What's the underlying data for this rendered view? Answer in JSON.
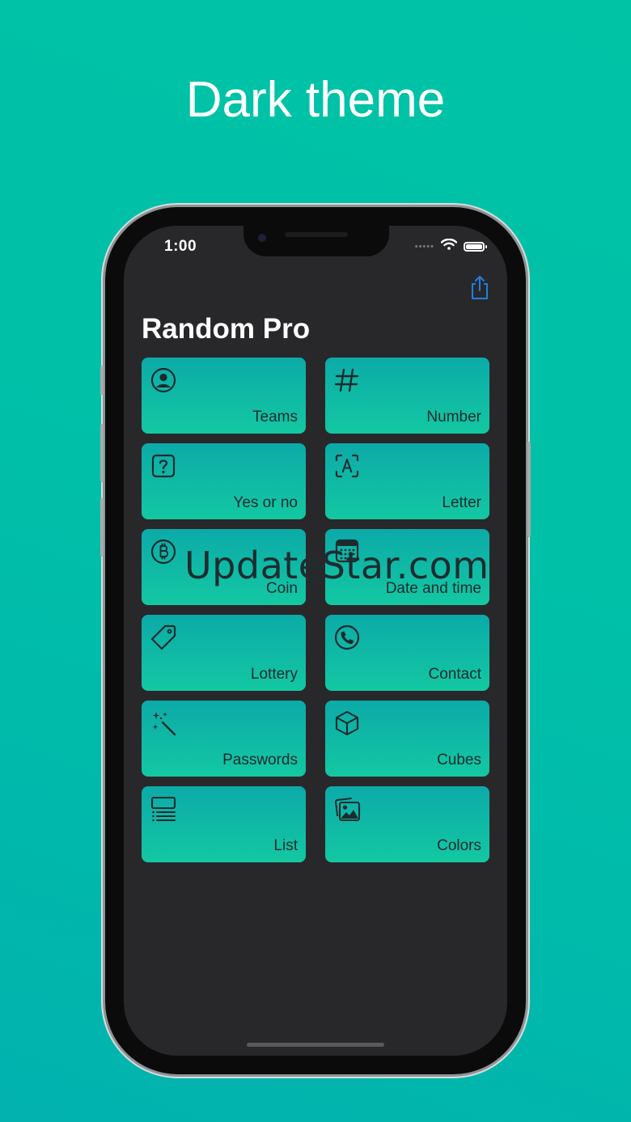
{
  "headline": "Dark theme",
  "status_bar": {
    "time": "1:00",
    "signal_dots": "•••••"
  },
  "app": {
    "title": "Random Pro",
    "accent_color": "#1f80e0",
    "tile_gradient": [
      "#0caaa8",
      "#13c8a2"
    ],
    "tiles": [
      {
        "label": "Teams",
        "icon": "person-circle-icon"
      },
      {
        "label": "Number",
        "icon": "hash-icon"
      },
      {
        "label": "Yes or no",
        "icon": "question-square-icon"
      },
      {
        "label": "Letter",
        "icon": "letter-a-icon"
      },
      {
        "label": "Coin",
        "icon": "bitcoin-icon"
      },
      {
        "label": "Date and time",
        "icon": "calendar-icon"
      },
      {
        "label": "Lottery",
        "icon": "tag-icon"
      },
      {
        "label": "Contact",
        "icon": "phone-circle-icon"
      },
      {
        "label": "Passwords",
        "icon": "magic-wand-icon"
      },
      {
        "label": "Cubes",
        "icon": "cube-icon"
      },
      {
        "label": "List",
        "icon": "list-icon"
      },
      {
        "label": "Colors",
        "icon": "photos-icon"
      }
    ]
  },
  "watermark": "UpdateStar.com"
}
